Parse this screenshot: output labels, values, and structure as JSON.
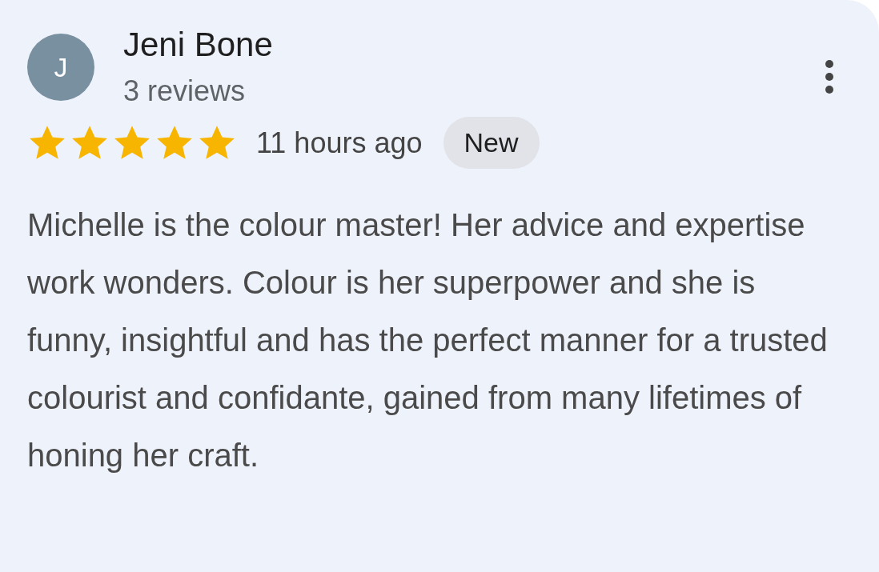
{
  "review": {
    "avatar_letter": "J",
    "author": "Jeni Bone",
    "review_count": "3 reviews",
    "stars": 5,
    "time": "11 hours ago",
    "badge": "New",
    "text": "Michelle is the colour master! Her advice and expertise work wonders. Colour is her superpower and she is funny, insightful and has the perfect manner for a trusted colourist and confidante, gained from many lifetimes of honing her craft."
  }
}
